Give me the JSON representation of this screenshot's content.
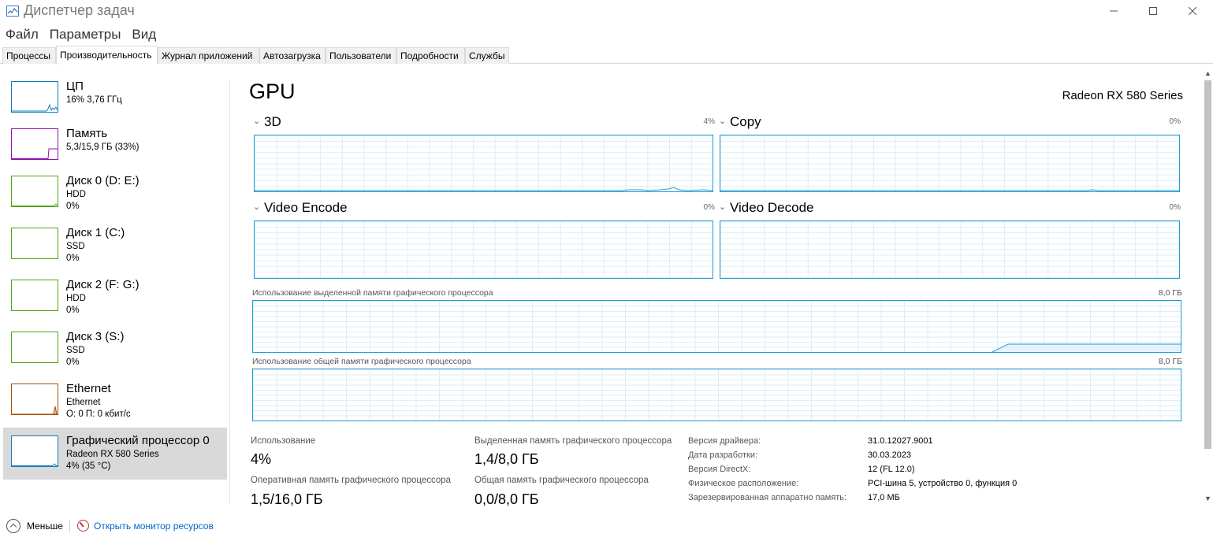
{
  "window": {
    "title": "Диспетчер задач",
    "icon": "task-manager-icon"
  },
  "menu": [
    "Файл",
    "Параметры",
    "Вид"
  ],
  "tabs": [
    {
      "label": "Процессы",
      "active": false
    },
    {
      "label": "Производительность",
      "active": true
    },
    {
      "label": "Журнал приложений",
      "active": false
    },
    {
      "label": "Автозагрузка",
      "active": false
    },
    {
      "label": "Пользователи",
      "active": false
    },
    {
      "label": "Подробности",
      "active": false
    },
    {
      "label": "Службы",
      "active": false
    }
  ],
  "sidebar": {
    "items": [
      {
        "title": "ЦП",
        "line1": "16% 3,76 ГГц",
        "line2": "",
        "color": "#117dbb",
        "active": false
      },
      {
        "title": "Память",
        "line1": "5,3/15,9 ГБ (33%)",
        "line2": "",
        "color": "#8b12ae",
        "active": false
      },
      {
        "title": "Диск 0 (D: E:)",
        "line1": "HDD",
        "line2": "0%",
        "color": "#4da60c",
        "active": false
      },
      {
        "title": "Диск 1 (C:)",
        "line1": "SSD",
        "line2": "0%",
        "color": "#4da60c",
        "active": false
      },
      {
        "title": "Диск 2 (F: G:)",
        "line1": "HDD",
        "line2": "0%",
        "color": "#4da60c",
        "active": false
      },
      {
        "title": "Диск 3 (S:)",
        "line1": "SSD",
        "line2": "0%",
        "color": "#4da60c",
        "active": false
      },
      {
        "title": "Ethernet",
        "line1": "Ethernet",
        "line2": "О: 0 П: 0 кбит/с",
        "color": "#a74f01",
        "active": false
      },
      {
        "title": "Графический процессор 0",
        "line1": "Radeon RX 580 Series",
        "line2": "4% (35 °C)",
        "color": "#117dbb",
        "active": true
      }
    ]
  },
  "main": {
    "title": "GPU",
    "model": "Radeon RX 580 Series",
    "engines": [
      {
        "name": "3D",
        "percent": "4%"
      },
      {
        "name": "Copy",
        "percent": "0%"
      },
      {
        "name": "Video Encode",
        "percent": "0%"
      },
      {
        "name": "Video Decode",
        "percent": "0%"
      }
    ],
    "dedicated_memory": {
      "label": "Использование выделенной памяти графического процессора",
      "max": "8,0 ГБ"
    },
    "shared_memory": {
      "label": "Использование общей памяти графического процессора",
      "max": "8,0 ГБ"
    },
    "stats": {
      "usage_label": "Использование",
      "usage_value": "4%",
      "dedicated_label": "Выделенная память графического процессора",
      "dedicated_value": "1,4/8,0 ГБ",
      "gpu_memory_label": "Оперативная память графического процессора",
      "gpu_memory_value": "1,5/16,0 ГБ",
      "shared_label": "Общая память графического процессора",
      "shared_value": "0,0/8,0 ГБ"
    },
    "details": [
      {
        "key": "Версия драйвера:",
        "value": "31.0.12027.9001"
      },
      {
        "key": "Дата разработки:",
        "value": "30.03.2023"
      },
      {
        "key": "Версия DirectX:",
        "value": "12 (FL 12.0)"
      },
      {
        "key": "Физическое расположение:",
        "value": "PCI-шина 5, устройство 0, функция 0"
      },
      {
        "key": "Зарезервированная аппаратно память:",
        "value": "17,0 МБ"
      }
    ]
  },
  "footer": {
    "less_label": "Меньше",
    "resource_monitor_label": "Открыть монитор ресурсов"
  },
  "colors": {
    "accent": "#1f9bd6",
    "grid": "#dbeef8",
    "active_item_bg": "#d9d9d9"
  }
}
